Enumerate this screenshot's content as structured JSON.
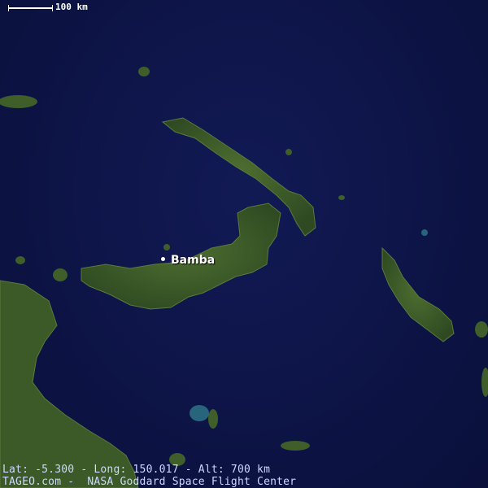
{
  "scale": {
    "label": "100 km"
  },
  "place": {
    "name": "Bamba"
  },
  "footer": {
    "coords": "Lat: -5.300 - Long: 150.017 - Alt: 700 km",
    "credit": "TAGEO.com -  NASA Goddard Space Flight Center"
  },
  "colors": {
    "ocean": "#0d1446",
    "land": "#3f5e2a",
    "shallow": "#3a9aa0"
  }
}
